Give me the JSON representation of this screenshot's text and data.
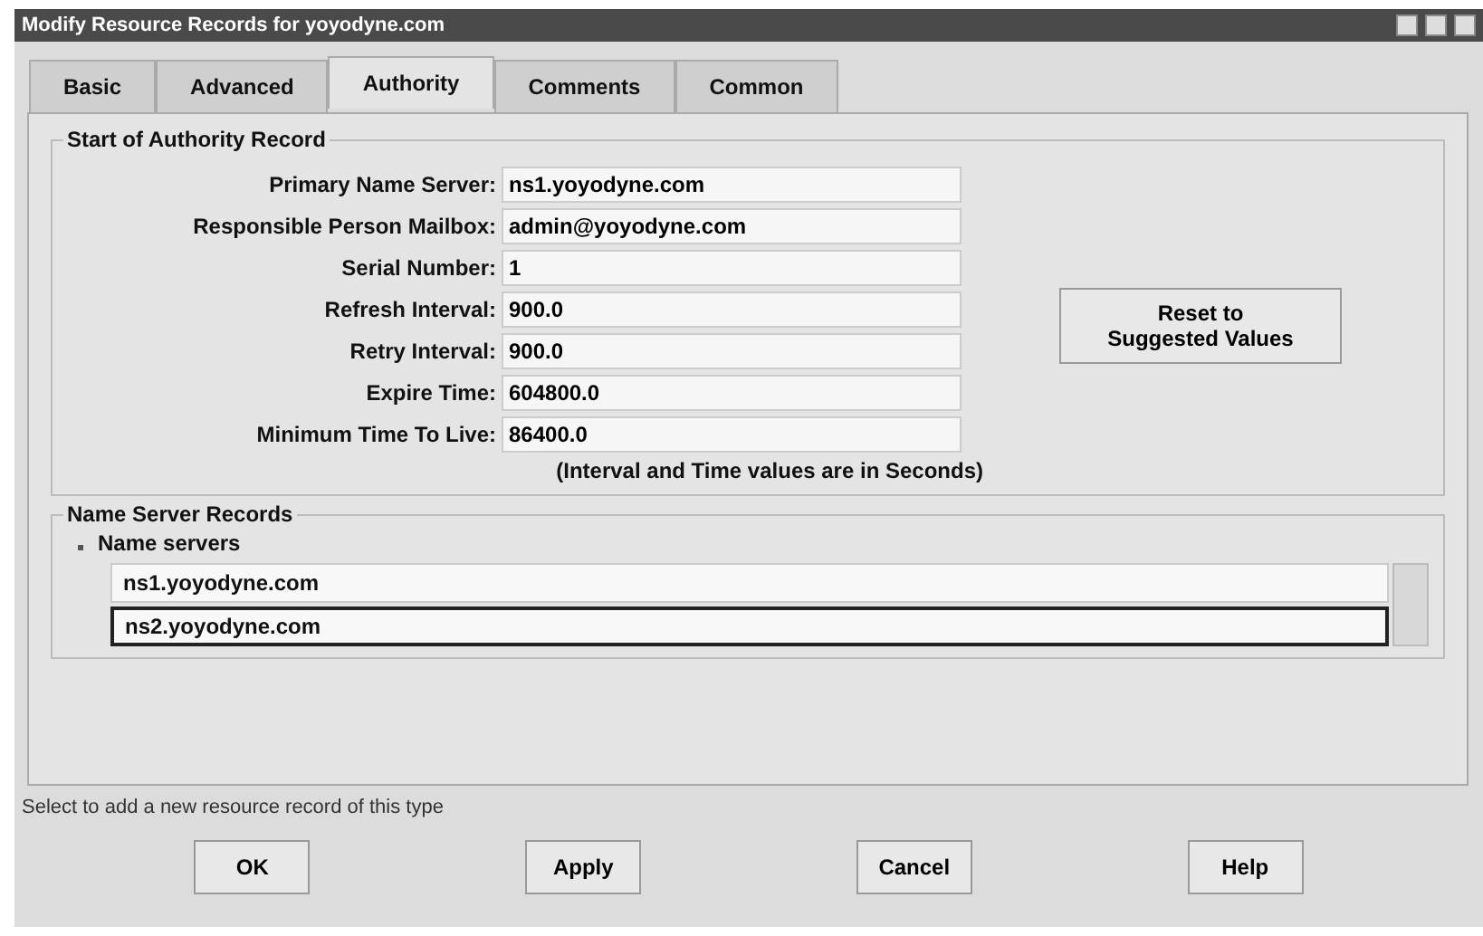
{
  "window": {
    "title": "Modify Resource Records for yoyodyne.com"
  },
  "tabs": [
    {
      "label": "Basic",
      "selected": false
    },
    {
      "label": "Advanced",
      "selected": false
    },
    {
      "label": "Authority",
      "selected": true
    },
    {
      "label": "Comments",
      "selected": false
    },
    {
      "label": "Common",
      "selected": false
    }
  ],
  "soa": {
    "title": "Start of Authority Record",
    "fields": [
      {
        "label": "Primary Name Server:",
        "value": "ns1.yoyodyne.com"
      },
      {
        "label": "Responsible Person Mailbox:",
        "value": "admin@yoyodyne.com"
      },
      {
        "label": "Serial Number:",
        "value": "1"
      },
      {
        "label": "Refresh Interval:",
        "value": "900.0"
      },
      {
        "label": "Retry Interval:",
        "value": "900.0"
      },
      {
        "label": "Expire Time:",
        "value": "604800.0"
      },
      {
        "label": "Minimum Time To Live:",
        "value": "86400.0"
      }
    ],
    "note": "(Interval and Time values are in Seconds)",
    "reset_button": [
      "Reset to",
      "Suggested Values"
    ]
  },
  "ns_records": {
    "title": "Name Server Records",
    "list_title": "Name servers",
    "rows": [
      {
        "value": "ns1.yoyodyne.com",
        "selected": false
      },
      {
        "value": "ns2.yoyodyne.com",
        "selected": true
      }
    ]
  },
  "status_bar": "Select to add a new resource record of this type",
  "buttons": [
    "OK",
    "Apply",
    "Cancel",
    "Help"
  ]
}
